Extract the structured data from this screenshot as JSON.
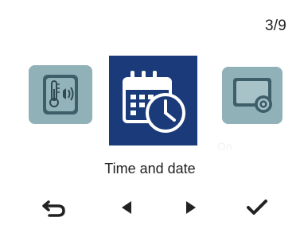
{
  "header": {
    "page_indicator": "3/9"
  },
  "carousel": {
    "items": [
      {
        "icon": "thermometer-signal-icon",
        "state": "previous"
      },
      {
        "icon": "calendar-clock-icon",
        "state": "selected",
        "label": "Time and date"
      },
      {
        "icon": "screen-settings-icon",
        "state": "next"
      }
    ],
    "ghost_text": "On"
  },
  "footer": {
    "buttons": [
      {
        "icon": "back-arrow-icon"
      },
      {
        "icon": "previous-arrow-icon"
      },
      {
        "icon": "next-arrow-icon"
      },
      {
        "icon": "checkmark-icon"
      }
    ]
  },
  "colors": {
    "selected_tile": "#1a3a7a",
    "side_tile": "#8fb1b7",
    "icon_dark": "#2f4a54",
    "nav_icon": "#222222"
  }
}
